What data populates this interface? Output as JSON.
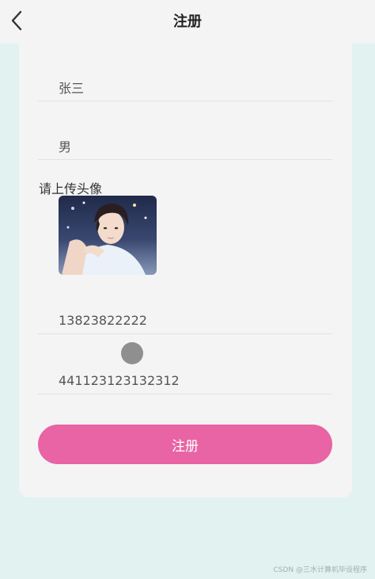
{
  "header": {
    "title": "注册"
  },
  "form": {
    "name_value": "张三",
    "gender_value": "男",
    "avatar_label": "请上传头像",
    "phone_value": "13823822222",
    "id_value": "441123123132312"
  },
  "submit": {
    "label": "注册"
  },
  "colors": {
    "page_background": "#e2f2f1",
    "card_background": "#f4f4f4",
    "accent": "#e864a4"
  },
  "watermark": {
    "text": "CSDN @三水计算机毕设程序"
  }
}
